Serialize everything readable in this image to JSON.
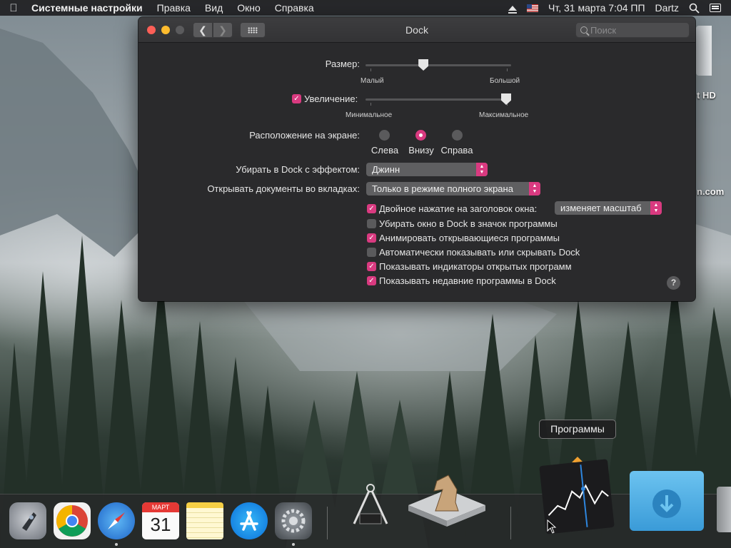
{
  "menubar": {
    "app_name": "Системные настройки",
    "menus": [
      "Правка",
      "Вид",
      "Окно",
      "Справка"
    ],
    "datetime": "Чт, 31 марта  7:04 ПП",
    "user": "Dartz"
  },
  "desktop": {
    "disk_label_fragment": "t HD",
    "site_label_fragment": "n.com"
  },
  "window": {
    "title": "Dock",
    "search_placeholder": "Поиск",
    "size": {
      "label": "Размер:",
      "min_label": "Малый",
      "max_label": "Большой",
      "value": 0.39
    },
    "magnification": {
      "label": "Увеличение:",
      "checked": true,
      "min_label": "Минимальное",
      "max_label": "Максимальное",
      "value": 1.0
    },
    "position": {
      "label": "Расположение на экране:",
      "options": [
        "Слева",
        "Внизу",
        "Справа"
      ],
      "selected": "Внизу"
    },
    "minimize_effect": {
      "label": "Убирать в Dock с эффектом:",
      "value": "Джинн"
    },
    "open_tabs": {
      "label": "Открывать документы во вкладках:",
      "value": "Только в режиме полного экрана"
    },
    "double_click": {
      "label": "Двойное нажатие на заголовок окна:",
      "checked": true,
      "value": "изменяет масштаб"
    },
    "checkboxes": [
      {
        "label": "Убирать окно в Dock в значок программы",
        "checked": false
      },
      {
        "label": "Анимировать открывающиеся программы",
        "checked": true
      },
      {
        "label": "Автоматически показывать или скрывать Dock",
        "checked": false
      },
      {
        "label": "Показывать индикаторы открытых программ",
        "checked": true
      },
      {
        "label": "Показывать недавние программы в Dock",
        "checked": true
      }
    ],
    "help_symbol": "?"
  },
  "dock": {
    "tooltip": "Программы",
    "calendar_month": "МАРТ",
    "calendar_day": "31",
    "items": [
      "launchpad-icon",
      "chrome-icon",
      "safari-icon",
      "calendar-icon",
      "notes-icon",
      "app-store-icon",
      "system-preferences-icon",
      "system-information-icon",
      "chess-icon",
      "stocks-icon",
      "downloads-folder-icon",
      "trash-icon"
    ]
  },
  "colors": {
    "accent": "#d93a80",
    "window_bg": "#2a2a2c",
    "menubar_bg": "#202022"
  }
}
